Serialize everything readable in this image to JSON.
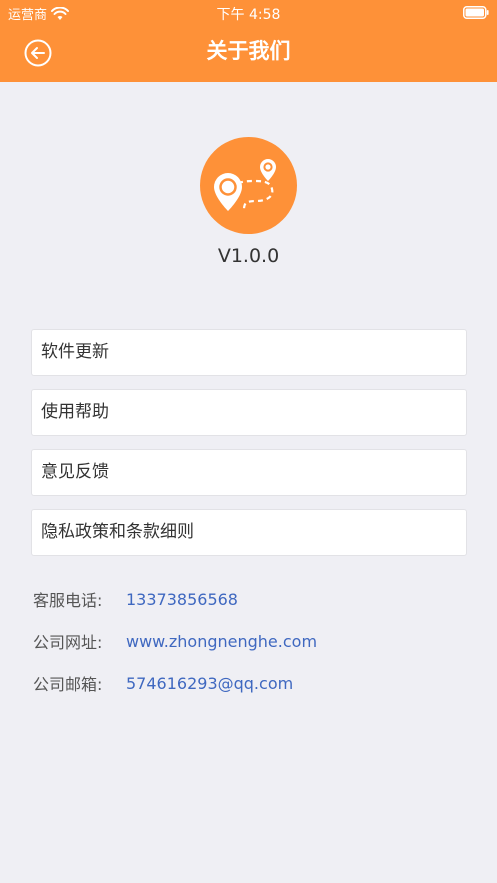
{
  "status_bar": {
    "carrier": "运营商",
    "time": "下午 4:58"
  },
  "header": {
    "title": "关于我们",
    "back_icon": "back-arrow-circle-icon"
  },
  "colors": {
    "accent": "#fe9138",
    "link": "#3f68c0",
    "background": "#efeff4"
  },
  "app": {
    "logo_icon": "map-route-pin-icon",
    "version": "V1.0.0"
  },
  "menu": [
    {
      "label": "软件更新"
    },
    {
      "label": "使用帮助"
    },
    {
      "label": "意见反馈"
    },
    {
      "label": "隐私政策和条款细则"
    }
  ],
  "contact": [
    {
      "label": "客服电话:",
      "value": "13373856568"
    },
    {
      "label": "公司网址:",
      "value": "www.zhongnenghe.com"
    },
    {
      "label": "公司邮箱:",
      "value": "574616293@qq.com"
    }
  ]
}
